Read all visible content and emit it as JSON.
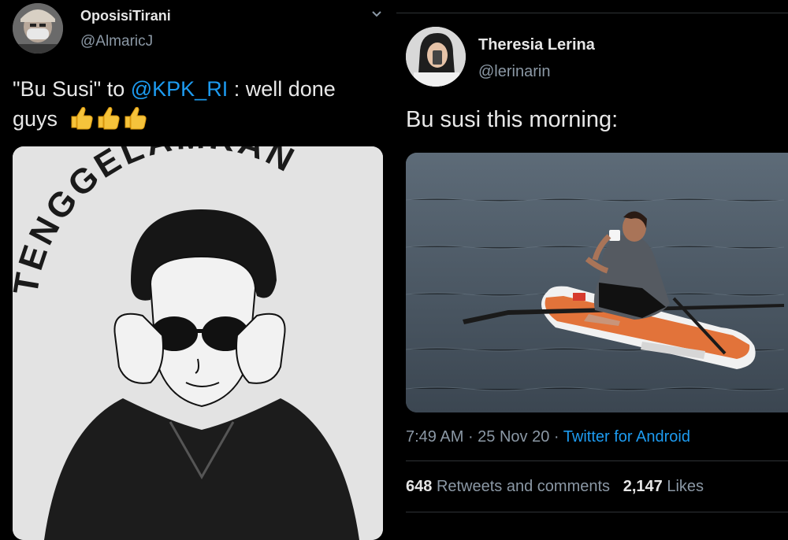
{
  "left_tweet": {
    "display_name": "OposisiTirani",
    "handle": "@AlmaricJ",
    "text_before": "\"Bu Susi\" to ",
    "mention": "@KPK_RI",
    "text_after": " : well done",
    "text_line2": "guys",
    "emoji_count": 3,
    "media_caption": "TENGGELAMKAN"
  },
  "right_tweet": {
    "display_name": "Theresia Lerina",
    "handle": "@lerinarin",
    "text": "Bu susi this morning:",
    "time": "7:49 AM",
    "date": "25 Nov 20",
    "source": "Twitter for Android",
    "retweets_count": "648",
    "retweets_label": "Retweets and comments",
    "likes_count": "2,147",
    "likes_label": "Likes"
  },
  "colors": {
    "background": "#000000",
    "link": "#1d9bf0",
    "secondary_text": "#8b98a5"
  }
}
